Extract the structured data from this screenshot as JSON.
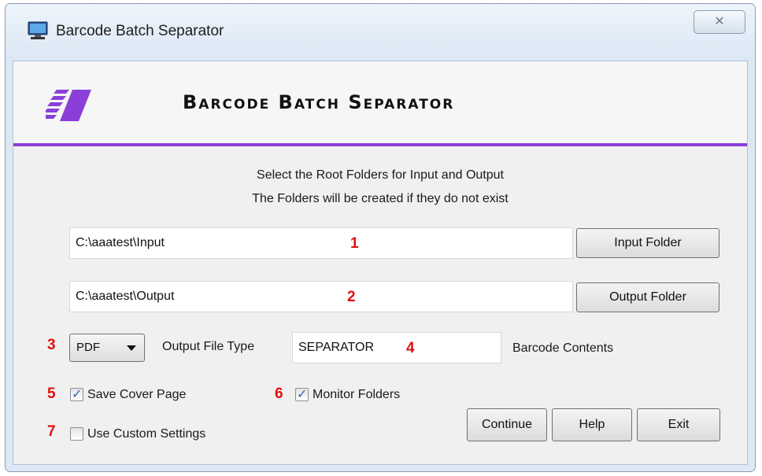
{
  "window": {
    "title": "Barcode Batch Separator",
    "close_glyph": "✕",
    "app_icon": "monitor-icon"
  },
  "header": {
    "title": "Barcode Batch Separator",
    "logo": "barcode-stripes-logo",
    "accent_color": "#8b3fd9"
  },
  "instructions": {
    "line1": "Select the Root Folders for Input and Output",
    "line2": "The Folders will be created if they do not exist"
  },
  "input_folder": {
    "value": "C:\\aaatest\\Input",
    "button_label": "Input Folder",
    "marker": "1"
  },
  "output_folder": {
    "value": "C:\\aaatest\\Output",
    "button_label": "Output Folder",
    "marker": "2"
  },
  "file_type": {
    "marker": "3",
    "selected": "PDF",
    "label": "Output File Type"
  },
  "barcode": {
    "marker": "4",
    "value": "SEPARATOR",
    "label": "Barcode Contents"
  },
  "save_cover": {
    "marker": "5",
    "label": "Save Cover Page",
    "checked": true
  },
  "monitor": {
    "marker": "6",
    "label": "Monitor Folders",
    "checked": true
  },
  "custom_settings": {
    "marker": "7",
    "label": "Use Custom Settings",
    "checked": false
  },
  "buttons": {
    "continue": "Continue",
    "help": "Help",
    "exit": "Exit"
  },
  "marker_color": "#e01010"
}
